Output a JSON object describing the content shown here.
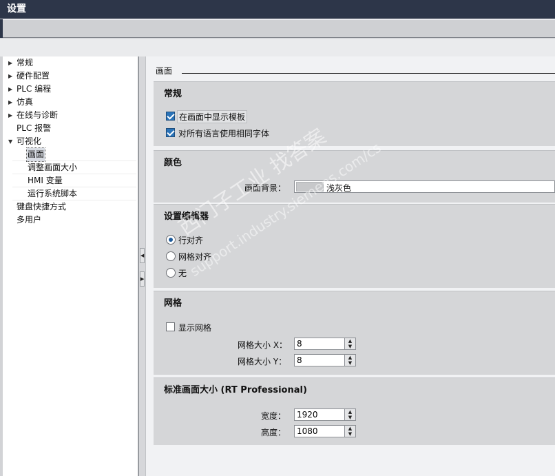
{
  "window": {
    "title": "设置"
  },
  "nav": {
    "items": [
      {
        "label": "常规",
        "arrow": "▶"
      },
      {
        "label": "硬件配置",
        "arrow": "▶"
      },
      {
        "label": "PLC 编程",
        "arrow": "▶"
      },
      {
        "label": "仿真",
        "arrow": "▶"
      },
      {
        "label": "在线与诊断",
        "arrow": "▶"
      },
      {
        "label": "PLC 报警",
        "arrow": ""
      },
      {
        "label": "可视化",
        "arrow": "▼"
      },
      {
        "label": "画面",
        "arrow": ""
      },
      {
        "label": "调整画面大小",
        "arrow": ""
      },
      {
        "label": "HMI 变量",
        "arrow": ""
      },
      {
        "label": "运行系统脚本",
        "arrow": ""
      },
      {
        "label": "键盘快捷方式",
        "arrow": ""
      },
      {
        "label": "多用户",
        "arrow": ""
      }
    ]
  },
  "main": {
    "title": "画面",
    "general": {
      "title": "常规",
      "show_template": {
        "label": "在画面中显示模板",
        "checked": true
      },
      "same_font": {
        "label": "对所有语言使用相同字体",
        "checked": true
      }
    },
    "color": {
      "title": "颜色",
      "background_label": "画面背景：",
      "background_value": "浅灰色",
      "swatch_color": "#c7c8ca"
    },
    "editor": {
      "title": "设置编辑器",
      "options": [
        {
          "label": "行对齐",
          "selected": true
        },
        {
          "label": "网格对齐",
          "selected": false
        },
        {
          "label": "无",
          "selected": false
        }
      ]
    },
    "grid": {
      "title": "网格",
      "show_grid": {
        "label": "显示网格",
        "checked": false
      },
      "size_x_label": "网格大小 X：",
      "size_x": "8",
      "size_y_label": "网格大小 Y：",
      "size_y": "8"
    },
    "standard_size": {
      "title": "标准画面大小 (RT Professional)",
      "width_label": "宽度：",
      "width": "1920",
      "height_label": "高度：",
      "height": "1080"
    }
  },
  "watermark": {
    "line1": "西门子工业 找答案",
    "line2": "support.industry.siemens.com/cs"
  },
  "icons": {
    "spin_up": "▲",
    "spin_down": "▼",
    "collapse_left": "◀",
    "expand_right": "▶"
  }
}
